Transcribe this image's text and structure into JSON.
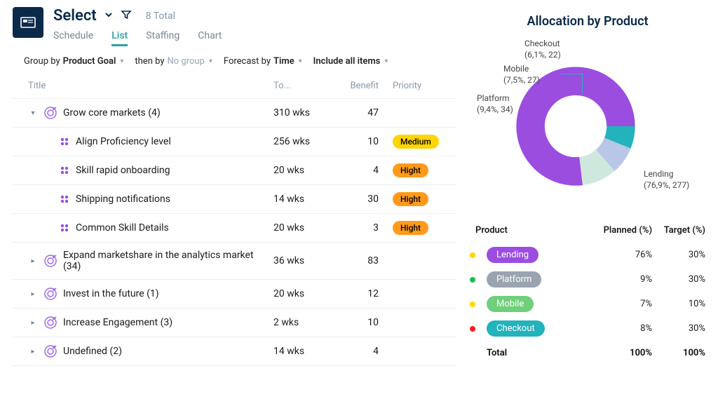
{
  "header": {
    "select_label": "Select",
    "total": "8 Total",
    "tabs": {
      "schedule": "Schedule",
      "list": "List",
      "staffing": "Staffing",
      "chart": "Chart"
    }
  },
  "toolbar": {
    "groupby_pref": "Group by",
    "groupby_val": "Product Goal",
    "thenby_pref": "then by",
    "thenby_val": "No group",
    "forecast_pref": "Forecast by",
    "forecast_val": "Time",
    "include": "Include all items"
  },
  "columns": {
    "title": "Title",
    "to": "To...",
    "benefit": "Benefit",
    "priority": "Priority"
  },
  "rows": {
    "g0": {
      "title": "Grow core markets (4)",
      "to": "310 wks",
      "benefit": "47"
    },
    "c0": {
      "title": "Align Proficiency level",
      "to": "256 wks",
      "benefit": "10",
      "prio": "Medium"
    },
    "c1": {
      "title": "Skill rapid onboarding",
      "to": "20 wks",
      "benefit": "4",
      "prio": "Hight"
    },
    "c2": {
      "title": "Shipping notifications",
      "to": "14 wks",
      "benefit": "30",
      "prio": "Hight"
    },
    "c3": {
      "title": "Common Skill Details",
      "to": "20 wks",
      "benefit": "3",
      "prio": "Hight"
    },
    "g1": {
      "title": "Expand marketshare in the analytics market (34)",
      "to": "36 wks",
      "benefit": "83"
    },
    "g2": {
      "title": "Invest in the future (1)",
      "to": "20 wks",
      "benefit": "12"
    },
    "g3": {
      "title": "Increase Engagement (3)",
      "to": "2 wks",
      "benefit": "10"
    },
    "g4": {
      "title": "Undefined (2)",
      "to": "14 wks",
      "benefit": "4"
    }
  },
  "chart": {
    "title": "Allocation by Product",
    "labels": {
      "checkout": {
        "name": "Checkout",
        "detail": "(6,1%, 22)"
      },
      "mobile": {
        "name": "Mobile",
        "detail": "(7,5%, 27)"
      },
      "platform": {
        "name": "Platform",
        "detail": "(9,4%, 34)"
      },
      "lending": {
        "name": "Lending",
        "detail": "(76,9%, 277)"
      }
    }
  },
  "chart_data": {
    "type": "pie",
    "title": "Allocation by Product",
    "categories": [
      "Lending",
      "Platform",
      "Mobile",
      "Checkout"
    ],
    "series": [
      {
        "name": "percent",
        "values": [
          76.9,
          9.4,
          7.5,
          6.1
        ]
      },
      {
        "name": "count",
        "values": [
          277,
          34,
          27,
          22
        ]
      }
    ],
    "colors": [
      "#9b4de0",
      "#cfe8dd",
      "#b8c6e8",
      "#22b3bd"
    ]
  },
  "table": {
    "header": {
      "product": "Product",
      "planned": "Planned (%)",
      "target": "Target (%)"
    },
    "r0": {
      "label": "Lending",
      "planned": "76%",
      "target": "30%"
    },
    "r1": {
      "label": "Platform",
      "planned": "9%",
      "target": "30%"
    },
    "r2": {
      "label": "Mobile",
      "planned": "7%",
      "target": "10%"
    },
    "r3": {
      "label": "Checkout",
      "planned": "8%",
      "target": "30%"
    },
    "total": {
      "label": "Total",
      "planned": "100%",
      "target": "100%"
    }
  }
}
